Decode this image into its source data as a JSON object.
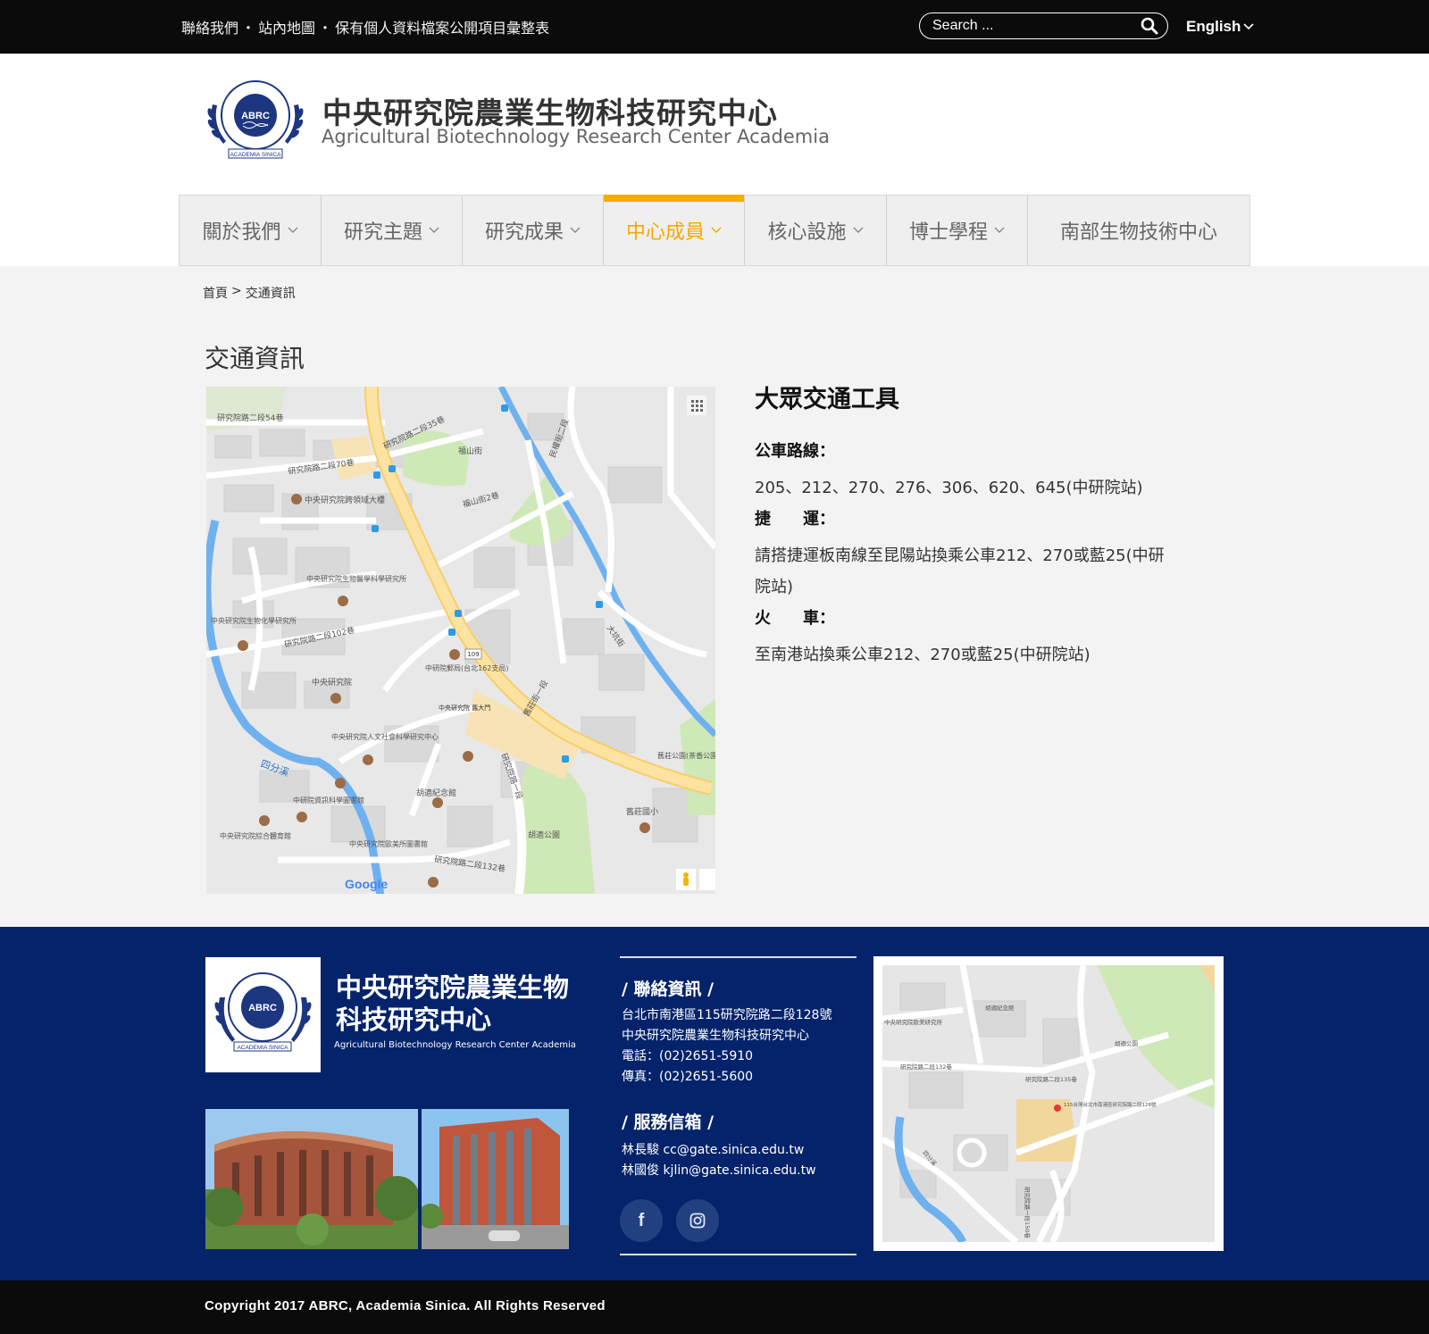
{
  "topbar": {
    "links": [
      "聯絡我們",
      "站內地圖",
      "保有個人資料檔案公開項目彙整表"
    ],
    "separator": "・",
    "search_placeholder": "Search ...",
    "language": "English"
  },
  "header": {
    "logo_text": "ABRC",
    "logo_caption": "ACADEMIA SINICA",
    "title_zh": "中央研究院農業生物科技研究中心",
    "title_en": "Agricultural Biotechnology Research Center Academia"
  },
  "nav": {
    "items": [
      {
        "label": "關於我們",
        "has_dropdown": true,
        "active": false
      },
      {
        "label": "研究主題",
        "has_dropdown": true,
        "active": false
      },
      {
        "label": "研究成果",
        "has_dropdown": true,
        "active": false
      },
      {
        "label": "中心成員",
        "has_dropdown": true,
        "active": true
      },
      {
        "label": "核心設施",
        "has_dropdown": true,
        "active": false
      },
      {
        "label": "博士學程",
        "has_dropdown": true,
        "active": false
      },
      {
        "label": "南部生物技術中心",
        "has_dropdown": false,
        "active": false
      }
    ],
    "active_color": "#f5ac00"
  },
  "breadcrumb": {
    "home": "首頁",
    "separator": ">",
    "current": "交通資訊"
  },
  "page": {
    "title": "交通資訊"
  },
  "map": {
    "labels": {
      "road1": "研究院路二段54巷",
      "road2": "研究院路二段35巷",
      "road3": "研究院路二段70巷",
      "road4": "研究院路二段102巷",
      "road5": "研究院路二段132巷",
      "road6": "研究院路一段",
      "road7": "舊莊街一段",
      "road8": "民權街二段",
      "road9": "大坑街",
      "road10": "福山街",
      "road11": "福山街2巷",
      "poi1": "中央研究院跨領域大樓",
      "poi2": "中央研究院生物醫學科學研究所",
      "poi3": "中央研究院生物化學研究所",
      "poi4": "中研院郵局(台北162支局)",
      "poi5": "中央研究院",
      "poi6": "中央研究院人文社會科學研究中心",
      "poi7": "中研院資訊科學圖書館",
      "poi8": "胡適紀念館",
      "poi9": "中央研究院綜合體育館",
      "poi10": "中央研究院歐美所圖書館",
      "poi11": "胡適公園",
      "poi12": "舊莊國小",
      "poi13": "舊莊公園(茶香公園)",
      "poi14": "四分溪",
      "poi15": "中央研究院 舊大門",
      "route": "109",
      "brand": "Google"
    }
  },
  "transit": {
    "heading": "大眾交通工具",
    "bus_label": "公車路線：",
    "bus_text": "205、212、270、276、306、620、645(中研院站)",
    "mrt_label_1": "捷",
    "mrt_label_2": "運：",
    "mrt_text": "請搭捷運板南線至昆陽站換乘公車212、270或藍25(中研院站)",
    "train_label_1": "火",
    "train_label_2": "車：",
    "train_text": "至南港站換乘公車212、270或藍25(中研院站)"
  },
  "footer": {
    "name_zh_line1": "中央研究院農業生物",
    "name_zh_line2": "科技研究中心",
    "name_en": "Agricultural Biotechnology Research Center Academia",
    "contact_heading": "/ 聯絡資訊 /",
    "contact_lines": [
      "台北市南港區115研究院路二段128號",
      "中央研究院農業生物科技研究中心",
      "電話：(02)2651-5910",
      "傳真：(02)2651-5600"
    ],
    "mail_heading": "/ 服務信箱 /",
    "mail_lines": [
      "林長駿  cc@gate.sinica.edu.tw",
      "林國俊  kjlin@gate.sinica.edu.tw"
    ],
    "social": [
      "facebook",
      "instagram"
    ],
    "map_labels": {
      "a": "胡適紀念館",
      "b": "胡適公園",
      "c": "研究院路二段132巷",
      "d": "115台灣台北市南港區研究院路二段128號",
      "e": "四分溪",
      "f": "研究院路一段150巷",
      "g": "中央研究院歐美研究所",
      "h": "研究院路二段135巷"
    },
    "bg_color": "#04236a"
  },
  "copyright": "Copyright 2017 ABRC, Academia Sinica. All Rights Reserved"
}
